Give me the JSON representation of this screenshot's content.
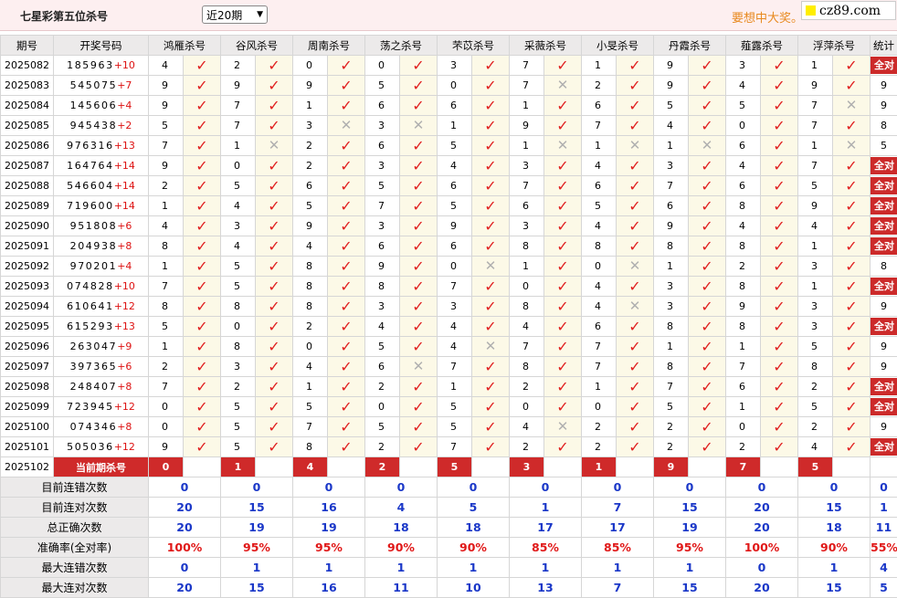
{
  "header": {
    "title": "七星彩第五位杀号",
    "period_select": "近20期",
    "promo": "要想中大奖。",
    "site": "cz89.com"
  },
  "columns": {
    "period": "期号",
    "numbers": "开奖号码",
    "experts": [
      "鸿雁杀号",
      "谷风杀号",
      "周南杀号",
      "荡之杀号",
      "芣苡杀号",
      "采薇杀号",
      "小旻杀号",
      "丹霞杀号",
      "薤露杀号",
      "浮萍杀号"
    ],
    "stats": "统计"
  },
  "all_correct_label": "全对",
  "rows": [
    {
      "period": "2025082",
      "nums": "185963",
      "sum": "+10",
      "v": [
        "4",
        "2",
        "0",
        "0",
        "3",
        "7",
        "1",
        "9",
        "3",
        "1"
      ],
      "r": [
        1,
        1,
        1,
        1,
        1,
        1,
        1,
        1,
        1,
        1
      ],
      "stat": "全对"
    },
    {
      "period": "2025083",
      "nums": "545075",
      "sum": "+7",
      "v": [
        "9",
        "9",
        "9",
        "5",
        "0",
        "7",
        "2",
        "9",
        "4",
        "9"
      ],
      "r": [
        1,
        1,
        1,
        1,
        1,
        0,
        1,
        1,
        1,
        1
      ],
      "stat": "9"
    },
    {
      "period": "2025084",
      "nums": "145606",
      "sum": "+4",
      "v": [
        "9",
        "7",
        "1",
        "6",
        "6",
        "1",
        "6",
        "5",
        "5",
        "7"
      ],
      "r": [
        1,
        1,
        1,
        1,
        1,
        1,
        1,
        1,
        1,
        0
      ],
      "stat": "9"
    },
    {
      "period": "2025085",
      "nums": "945438",
      "sum": "+2",
      "v": [
        "5",
        "7",
        "3",
        "3",
        "1",
        "9",
        "7",
        "4",
        "0",
        "7"
      ],
      "r": [
        1,
        1,
        0,
        0,
        1,
        1,
        1,
        1,
        1,
        1
      ],
      "stat": "8"
    },
    {
      "period": "2025086",
      "nums": "976316",
      "sum": "+13",
      "v": [
        "7",
        "1",
        "2",
        "6",
        "5",
        "1",
        "1",
        "1",
        "6",
        "1"
      ],
      "r": [
        1,
        0,
        1,
        1,
        1,
        0,
        0,
        0,
        1,
        0
      ],
      "stat": "5"
    },
    {
      "period": "2025087",
      "nums": "164764",
      "sum": "+14",
      "v": [
        "9",
        "0",
        "2",
        "3",
        "4",
        "3",
        "4",
        "3",
        "4",
        "7"
      ],
      "r": [
        1,
        1,
        1,
        1,
        1,
        1,
        1,
        1,
        1,
        1
      ],
      "stat": "全对"
    },
    {
      "period": "2025088",
      "nums": "546604",
      "sum": "+14",
      "v": [
        "2",
        "5",
        "6",
        "5",
        "6",
        "7",
        "6",
        "7",
        "6",
        "5"
      ],
      "r": [
        1,
        1,
        1,
        1,
        1,
        1,
        1,
        1,
        1,
        1
      ],
      "stat": "全对"
    },
    {
      "period": "2025089",
      "nums": "719600",
      "sum": "+14",
      "v": [
        "1",
        "4",
        "5",
        "7",
        "5",
        "6",
        "5",
        "6",
        "8",
        "9"
      ],
      "r": [
        1,
        1,
        1,
        1,
        1,
        1,
        1,
        1,
        1,
        1
      ],
      "stat": "全对"
    },
    {
      "period": "2025090",
      "nums": "951808",
      "sum": "+6",
      "v": [
        "4",
        "3",
        "9",
        "3",
        "9",
        "3",
        "4",
        "9",
        "4",
        "4"
      ],
      "r": [
        1,
        1,
        1,
        1,
        1,
        1,
        1,
        1,
        1,
        1
      ],
      "stat": "全对"
    },
    {
      "period": "2025091",
      "nums": "204938",
      "sum": "+8",
      "v": [
        "8",
        "4",
        "4",
        "6",
        "6",
        "8",
        "8",
        "8",
        "8",
        "1"
      ],
      "r": [
        1,
        1,
        1,
        1,
        1,
        1,
        1,
        1,
        1,
        1
      ],
      "stat": "全对"
    },
    {
      "period": "2025092",
      "nums": "970201",
      "sum": "+4",
      "v": [
        "1",
        "5",
        "8",
        "9",
        "0",
        "1",
        "0",
        "1",
        "2",
        "3"
      ],
      "r": [
        1,
        1,
        1,
        1,
        0,
        1,
        0,
        1,
        1,
        1
      ],
      "stat": "8"
    },
    {
      "period": "2025093",
      "nums": "074828",
      "sum": "+10",
      "v": [
        "7",
        "5",
        "8",
        "8",
        "7",
        "0",
        "4",
        "3",
        "8",
        "1"
      ],
      "r": [
        1,
        1,
        1,
        1,
        1,
        1,
        1,
        1,
        1,
        1
      ],
      "stat": "全对"
    },
    {
      "period": "2025094",
      "nums": "610641",
      "sum": "+12",
      "v": [
        "8",
        "8",
        "8",
        "3",
        "3",
        "8",
        "4",
        "3",
        "9",
        "3"
      ],
      "r": [
        1,
        1,
        1,
        1,
        1,
        1,
        0,
        1,
        1,
        1
      ],
      "stat": "9"
    },
    {
      "period": "2025095",
      "nums": "615293",
      "sum": "+13",
      "v": [
        "5",
        "0",
        "2",
        "4",
        "4",
        "4",
        "6",
        "8",
        "8",
        "3"
      ],
      "r": [
        1,
        1,
        1,
        1,
        1,
        1,
        1,
        1,
        1,
        1
      ],
      "stat": "全对"
    },
    {
      "period": "2025096",
      "nums": "263047",
      "sum": "+9",
      "v": [
        "1",
        "8",
        "0",
        "5",
        "4",
        "7",
        "7",
        "1",
        "1",
        "5"
      ],
      "r": [
        1,
        1,
        1,
        1,
        0,
        1,
        1,
        1,
        1,
        1
      ],
      "stat": "9"
    },
    {
      "period": "2025097",
      "nums": "397365",
      "sum": "+6",
      "v": [
        "2",
        "3",
        "4",
        "6",
        "7",
        "8",
        "7",
        "8",
        "7",
        "8"
      ],
      "r": [
        1,
        1,
        1,
        0,
        1,
        1,
        1,
        1,
        1,
        1
      ],
      "stat": "9"
    },
    {
      "period": "2025098",
      "nums": "248407",
      "sum": "+8",
      "v": [
        "7",
        "2",
        "1",
        "2",
        "1",
        "2",
        "1",
        "7",
        "6",
        "2"
      ],
      "r": [
        1,
        1,
        1,
        1,
        1,
        1,
        1,
        1,
        1,
        1
      ],
      "stat": "全对"
    },
    {
      "period": "2025099",
      "nums": "723945",
      "sum": "+12",
      "v": [
        "0",
        "5",
        "5",
        "0",
        "5",
        "0",
        "0",
        "5",
        "1",
        "5"
      ],
      "r": [
        1,
        1,
        1,
        1,
        1,
        1,
        1,
        1,
        1,
        1
      ],
      "stat": "全对"
    },
    {
      "period": "2025100",
      "nums": "074346",
      "sum": "+8",
      "v": [
        "0",
        "5",
        "7",
        "5",
        "5",
        "4",
        "2",
        "2",
        "0",
        "2"
      ],
      "r": [
        1,
        1,
        1,
        1,
        1,
        0,
        1,
        1,
        1,
        1
      ],
      "stat": "9"
    },
    {
      "period": "2025101",
      "nums": "505036",
      "sum": "+12",
      "v": [
        "9",
        "5",
        "8",
        "2",
        "7",
        "2",
        "2",
        "2",
        "2",
        "4"
      ],
      "r": [
        1,
        1,
        1,
        1,
        1,
        1,
        1,
        1,
        1,
        1
      ],
      "stat": "全对"
    }
  ],
  "current": {
    "period": "2025102",
    "label": "当前期杀号",
    "v": [
      "0",
      "1",
      "4",
      "2",
      "5",
      "3",
      "1",
      "9",
      "7",
      "5"
    ]
  },
  "stats": [
    {
      "label": "目前连错次数",
      "v": [
        "0",
        "0",
        "0",
        "0",
        "0",
        "0",
        "0",
        "0",
        "0",
        "0"
      ],
      "total": "0",
      "color": "blue"
    },
    {
      "label": "目前连对次数",
      "v": [
        "20",
        "15",
        "16",
        "4",
        "5",
        "1",
        "7",
        "15",
        "20",
        "15"
      ],
      "total": "1",
      "color": "blue"
    },
    {
      "label": "总正确次数",
      "v": [
        "20",
        "19",
        "19",
        "18",
        "18",
        "17",
        "17",
        "19",
        "20",
        "18"
      ],
      "total": "11",
      "color": "blue"
    },
    {
      "label": "准确率(全对率)",
      "v": [
        "100%",
        "95%",
        "95%",
        "90%",
        "90%",
        "85%",
        "85%",
        "95%",
        "100%",
        "90%"
      ],
      "total": "55%",
      "color": "red"
    },
    {
      "label": "最大连错次数",
      "v": [
        "0",
        "1",
        "1",
        "1",
        "1",
        "1",
        "1",
        "1",
        "0",
        "1"
      ],
      "total": "4",
      "color": "blue"
    },
    {
      "label": "最大连对次数",
      "v": [
        "20",
        "15",
        "16",
        "11",
        "10",
        "13",
        "7",
        "15",
        "20",
        "15"
      ],
      "total": "5",
      "color": "blue"
    }
  ]
}
